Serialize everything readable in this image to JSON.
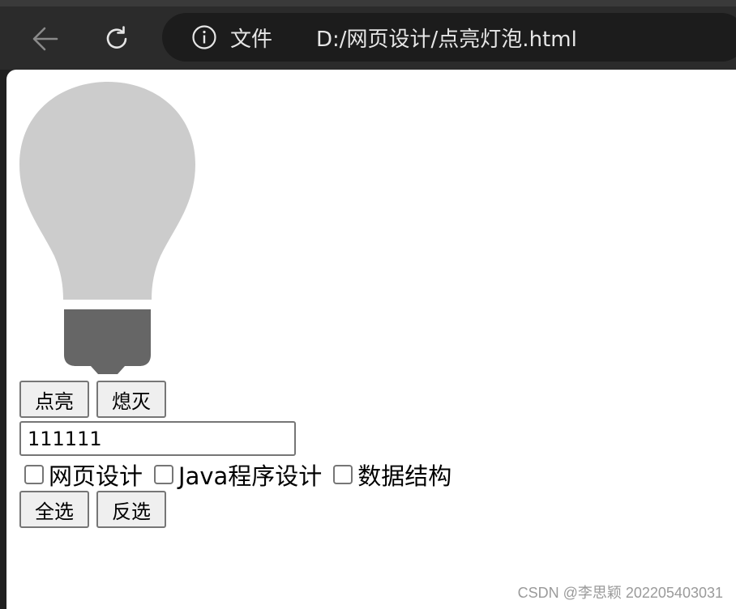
{
  "browser": {
    "back_icon": "arrow-left-icon",
    "reload_icon": "reload-icon",
    "info_icon": "info-icon",
    "site_label": "文件",
    "url": "D:/网页设计/点亮灯泡.html"
  },
  "page": {
    "bulb_icon": "lightbulb-icon",
    "bulb_state": "off",
    "bulb_color": "#cccccc",
    "base_color": "#666666",
    "buttons_top": {
      "on_label": "点亮",
      "off_label": "熄灭"
    },
    "text_input": {
      "value": "111111"
    },
    "checkboxes": [
      {
        "label": "网页设计",
        "checked": false
      },
      {
        "label": "Java程序设计",
        "checked": false
      },
      {
        "label": "数据结构",
        "checked": false
      }
    ],
    "buttons_bottom": {
      "select_all_label": "全选",
      "invert_label": "反选"
    }
  },
  "watermark": "CSDN @李思颖 202205403031"
}
